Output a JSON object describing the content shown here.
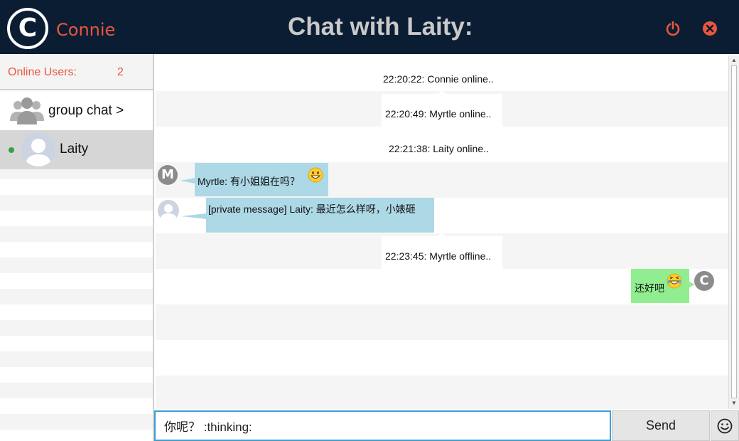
{
  "header": {
    "logo_letter": "C",
    "username": "Connie",
    "title": "Chat with Laity:",
    "accent_color": "#e8573c",
    "background_color": "#0b1d33",
    "icons": [
      "power-icon",
      "close-icon"
    ]
  },
  "sidebar": {
    "online_label": "Online Users:",
    "online_count": "2",
    "group_label": "group chat >",
    "users": [
      {
        "name": "Laity",
        "status": "online"
      }
    ]
  },
  "messages": {
    "sys1": "22:20:22: Connie online..",
    "sys2": "22:20:49: Myrtle online..",
    "sys3": "22:21:38: Laity online..",
    "myrtle_avatar": "M",
    "myrtle_text": "Myrtle: 有小姐姐在吗？",
    "laity_text": "[private message] Laity: 最近怎么样呀，小婊砸",
    "sys4": "22:23:45: Myrtle offline..",
    "self_avatar": "C",
    "self_text": "还好吧",
    "emojis": [
      "grinning-emoji",
      "laughing-emoji"
    ]
  },
  "composer": {
    "input_value": "你呢？ :thinking:",
    "send_label": "Send"
  }
}
